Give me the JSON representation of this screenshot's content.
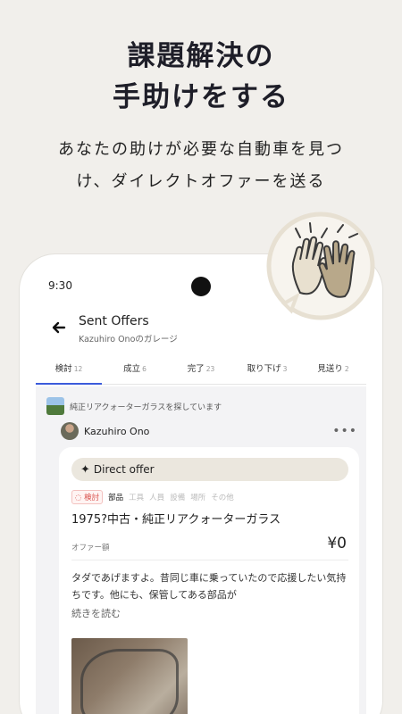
{
  "headline": {
    "line1": "課題解決の",
    "line2": "手助けをする"
  },
  "subline": {
    "line1": "あなたの助けが必要な自動車を見つ",
    "line2": "け、ダイレクトオファーを送る"
  },
  "status_bar": {
    "time": "9:30"
  },
  "app_bar": {
    "title": "Sent Offers",
    "subtitle": "Kazuhiro Onoのガレージ"
  },
  "tabs": [
    {
      "label": "検討",
      "count": "12"
    },
    {
      "label": "成立",
      "count": "6"
    },
    {
      "label": "完了",
      "count": "23"
    },
    {
      "label": "取り下げ",
      "count": "3"
    },
    {
      "label": "見送り",
      "count": "2"
    }
  ],
  "request": {
    "text": "純正リアクォーターガラスを探しています"
  },
  "user": {
    "name": "Kazuhiro Ono"
  },
  "card": {
    "offer_label": "Direct offer",
    "status": "検討",
    "categories": [
      "部品",
      "工具",
      "人員",
      "設備",
      "場所",
      "その他"
    ],
    "item_title": "1975?中古・純正リアクォーターガラス",
    "price_label": "オファー額",
    "price": "¥0",
    "message": "タダであげますよ。昔同じ車に乗っていたので応援したい気持ちです。他にも、保管してある部品が",
    "read_more": "続きを読む"
  },
  "icons": [
    "back-arrow-icon",
    "more-icon",
    "sparkle-icon",
    "high-five-icon"
  ],
  "colors": {
    "accent": "#3b5bdb",
    "background": "#f1efeb",
    "pill": "#ebe7de",
    "status": "#d9534f"
  }
}
